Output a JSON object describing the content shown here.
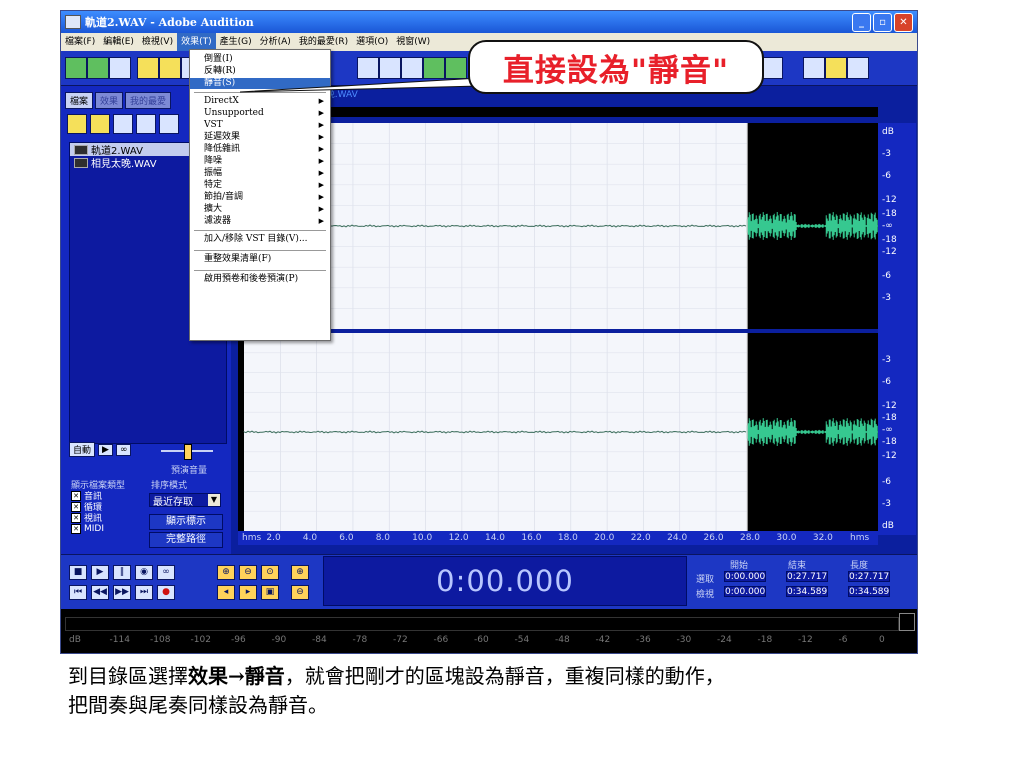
{
  "window": {
    "title": "軌道2.WAV - Adobe Audition"
  },
  "menubar": [
    "檔案(F)",
    "編輯(E)",
    "檢視(V)",
    "效果(T)",
    "產生(G)",
    "分析(A)",
    "我的最愛(R)",
    "選項(O)",
    "視窗(W)"
  ],
  "effects_menu": {
    "items": [
      {
        "label": "倒置(I)"
      },
      {
        "label": "反轉(R)"
      },
      {
        "label": "靜音(S)",
        "selected": true
      },
      {
        "label": "DirectX",
        "submenu": true
      },
      {
        "label": "Unsupported",
        "submenu": true
      },
      {
        "label": "VST",
        "submenu": true
      },
      {
        "label": "延遲效果",
        "submenu": true
      },
      {
        "label": "降低雜訊",
        "submenu": true
      },
      {
        "label": "降噪",
        "submenu": true
      },
      {
        "label": "振幅",
        "submenu": true
      },
      {
        "label": "特定",
        "submenu": true
      },
      {
        "label": "節拍/音調",
        "submenu": true
      },
      {
        "label": "擴大",
        "submenu": true
      },
      {
        "label": "濾波器",
        "submenu": true
      },
      {
        "label": "加入/移除 VST 目錄(V)..."
      },
      {
        "label": "重整效果清單(F)"
      },
      {
        "label": "啟用預卷和後卷預演(P)"
      }
    ]
  },
  "callout": {
    "text": "直接設為\"靜音\""
  },
  "left_panel": {
    "tabs": [
      "檔案",
      "效果",
      "我的最愛"
    ],
    "files": [
      "軌道2.WAV",
      "相見太晚.WAV"
    ],
    "auto_label": "自動",
    "volume_label": "預演音量",
    "volume_level": 0.5,
    "show_types_label": "顯示檔案類型",
    "sort_label": "排序模式",
    "types": [
      "音訊",
      "循環",
      "視訊",
      "MIDI"
    ],
    "sort_value": "最近存取",
    "show_tag_button": "顯示標示",
    "full_path_button": "完整路徑"
  },
  "editor": {
    "top_label": "(1)相見太晚.WAV",
    "db_scale_top": [
      "dB",
      "-3",
      "-6",
      "-12",
      "-18",
      "-∞",
      "-18",
      "-12",
      "-6",
      "-3"
    ],
    "db_scale_bottom": [
      "-3",
      "-6",
      "-12",
      "-18",
      "-∞",
      "-18",
      "-12",
      "-6",
      "-3",
      "dB"
    ],
    "time_ticks": [
      "hms",
      "2.0",
      "4.0",
      "6.0",
      "8.0",
      "10.0",
      "12.0",
      "14.0",
      "16.0",
      "18.0",
      "20.0",
      "22.0",
      "24.0",
      "26.0",
      "28.0",
      "30.0",
      "32.0",
      "hms"
    ],
    "selection_start_s": 0,
    "selection_end_s": 27.717,
    "total_s": 34.589
  },
  "transport": {
    "time": "0:00.000",
    "buttons": [
      "stop",
      "play",
      "pause",
      "play-loop",
      "loop",
      "goto-start",
      "rewind",
      "fast-forward",
      "goto-end",
      "record"
    ]
  },
  "selection_info": {
    "headers": [
      "開始",
      "結束",
      "長度"
    ],
    "rows": [
      {
        "label": "選取",
        "start": "0:00.000",
        "end": "0:27.717",
        "length": "0:27.717"
      },
      {
        "label": "檢視",
        "start": "0:00.000",
        "end": "0:34.589",
        "length": "0:34.589"
      }
    ]
  },
  "level_meter": {
    "marks": [
      "dB",
      "-114",
      "-108",
      "-102",
      "-96",
      "-90",
      "-84",
      "-78",
      "-72",
      "-66",
      "-60",
      "-54",
      "-48",
      "-42",
      "-36",
      "-30",
      "-24",
      "-18",
      "-12",
      "-6",
      "0"
    ]
  },
  "caption": {
    "line1_pre": "到目錄區選擇",
    "line1_bold": "效果→靜音",
    "line1_post": "，就會把剛才的區塊設為靜音，重複同樣的動作，",
    "line2": "把間奏與尾奏同樣設為靜音。"
  },
  "colors": {
    "panel": "#1428c0",
    "toolbar": "#1d37c4",
    "wave": "#1f8f7a",
    "callout_text": "#e8202a"
  }
}
